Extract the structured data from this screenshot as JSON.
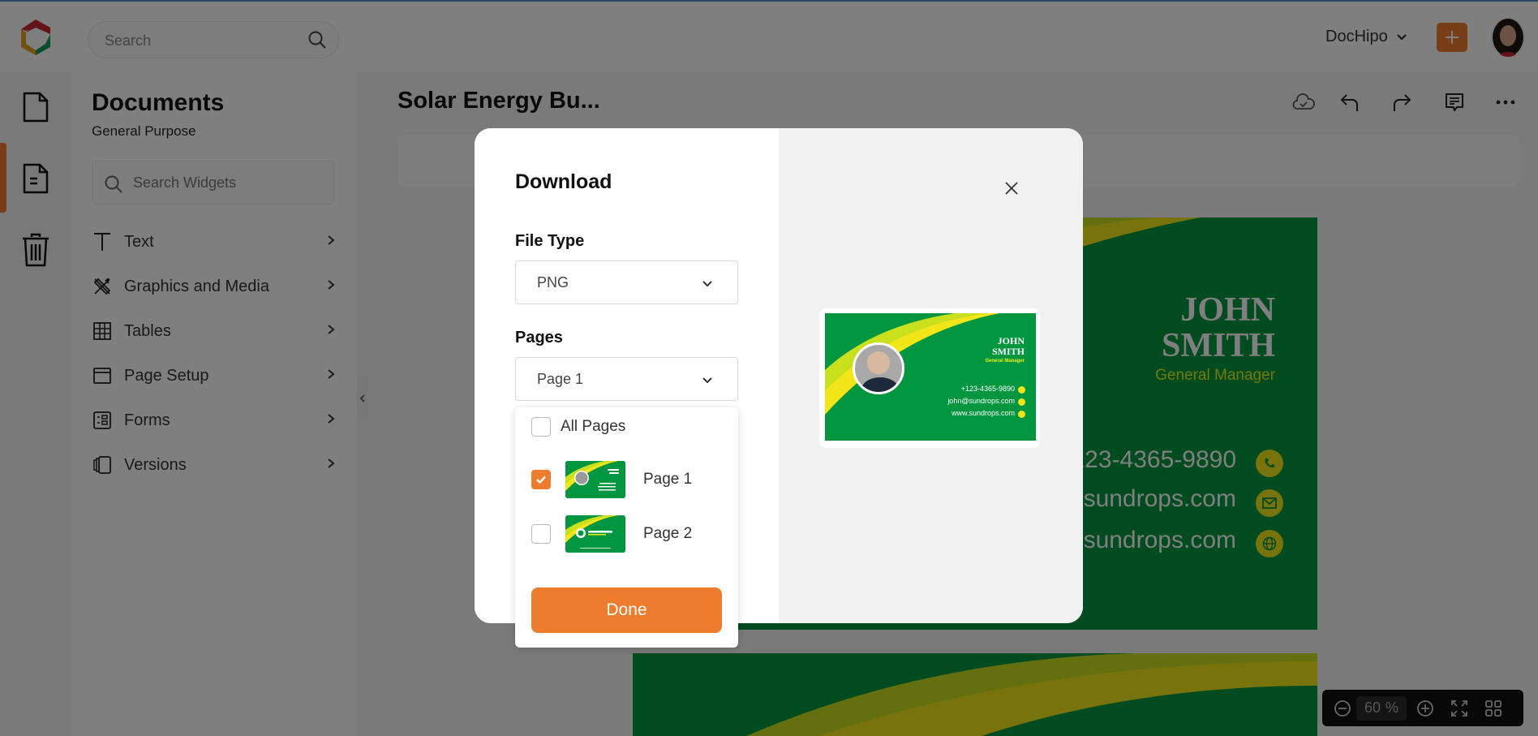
{
  "topbar": {
    "search_placeholder": "Search",
    "workspace_name": "DocHipo"
  },
  "panel": {
    "title": "Documents",
    "subtitle": "General Purpose",
    "widget_search_placeholder": "Search Widgets",
    "items": [
      {
        "label": "Text",
        "icon": "text-icon"
      },
      {
        "label": "Graphics and Media",
        "icon": "graphics-icon"
      },
      {
        "label": "Tables",
        "icon": "table-icon"
      },
      {
        "label": "Page Setup",
        "icon": "page-setup-icon"
      },
      {
        "label": "Forms",
        "icon": "forms-icon"
      },
      {
        "label": "Versions",
        "icon": "versions-icon"
      }
    ]
  },
  "editor": {
    "doc_title": "Solar Energy Bu...",
    "zoom_value": "60",
    "zoom_unit": "%"
  },
  "card": {
    "name_line1": "JOHN",
    "name_line2": "SMITH",
    "role": "General Manager",
    "phone": "+123-4365-9890",
    "email": "john@sundrops.com",
    "website": "www.sundrops.com",
    "colors": {
      "green": "#00963f",
      "yellow": "#f2e61a",
      "lime": "#c8e01e"
    }
  },
  "modal": {
    "title": "Download",
    "file_type_label": "File Type",
    "file_type_value": "PNG",
    "pages_label": "Pages",
    "pages_value": "Page 1",
    "options": [
      {
        "label": "All Pages",
        "checked": false
      },
      {
        "label": "Page 1",
        "checked": true
      },
      {
        "label": "Page 2",
        "checked": false
      }
    ],
    "done_label": "Done",
    "accent": "#ee7c2f"
  }
}
